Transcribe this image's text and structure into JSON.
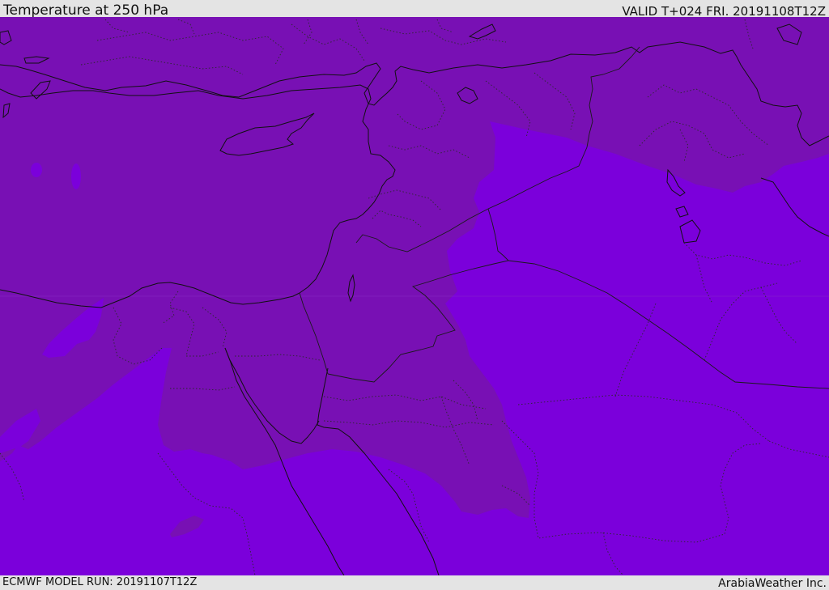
{
  "header": {
    "title": "Temperature at 250 hPa",
    "valid_time": "VALID T+024 FRI. 20191108T12Z"
  },
  "footer": {
    "model_run": "ECMWF MODEL RUN: 20191107T12Z",
    "credit": "ArabiaWeather Inc."
  },
  "map": {
    "region": "Eastern Mediterranean and Middle East",
    "field": "Temperature at 250 hPa",
    "colors": {
      "cold_zone": "#7810b4",
      "warm_zone": "#7b00db",
      "coastlines": "#111111",
      "borders": "#222222"
    }
  }
}
